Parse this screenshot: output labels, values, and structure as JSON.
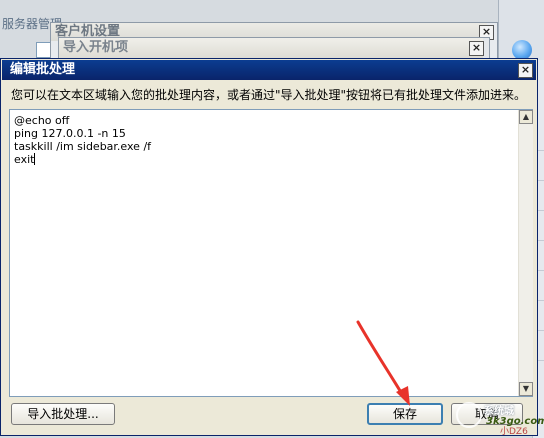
{
  "background": {
    "server_manager_title": "服务器管理",
    "client_settings_title": "客户机设置",
    "import_startup_title": "导入开机项",
    "bottom_fragment": "小DZ6"
  },
  "dialog": {
    "title": "编辑批处理",
    "instruction": "您可以在文本区域输入您的批处理内容，或者通过\"导入批处理\"按钮将已有批处理文件添加进来。",
    "script_lines": [
      "@echo off",
      "ping 127.0.0.1 -n 15",
      "taskkill /im sidebar.exe /f",
      "exit"
    ],
    "buttons": {
      "import": "导入批处理...",
      "save": "保存",
      "cancel": "取消"
    }
  },
  "watermark": {
    "line1": "系统城",
    "line2": "3k3go.com"
  },
  "colors": {
    "titlebar": "#0a246a",
    "arrow": "#e8332a",
    "dialog_bg": "#ece9d8"
  }
}
